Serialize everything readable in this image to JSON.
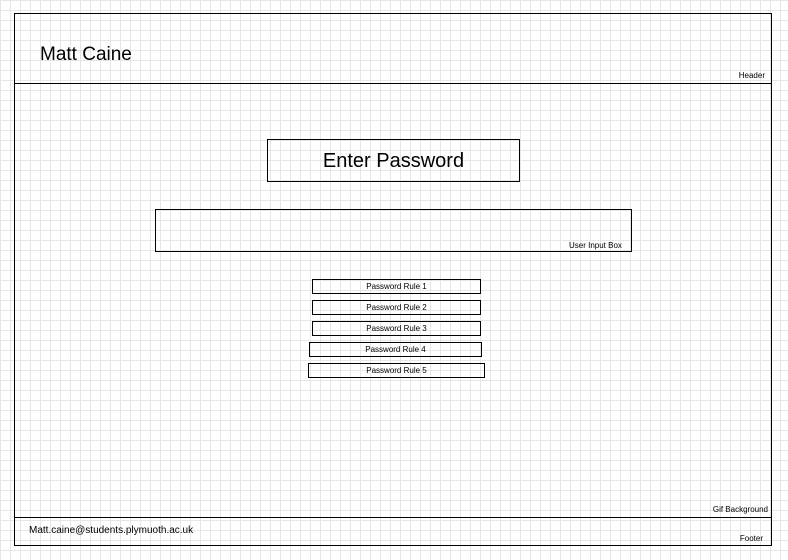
{
  "header": {
    "title": "Matt Caine",
    "label": "Header"
  },
  "main": {
    "title": "Enter Password",
    "input": {
      "value": "",
      "label": "User Input Box"
    },
    "rules": [
      "Password Rule 1",
      "Password Rule 2",
      "Password Rule 3",
      "Password Rule 4",
      "Password Rule 5"
    ],
    "background_label": "Gif Background"
  },
  "footer": {
    "email": "Matt.caine@students.plymuoth.ac.uk",
    "label": "Footer"
  },
  "colors": {
    "line": "#000000",
    "grid": "#e6e6e6",
    "background": "#ffffff"
  }
}
